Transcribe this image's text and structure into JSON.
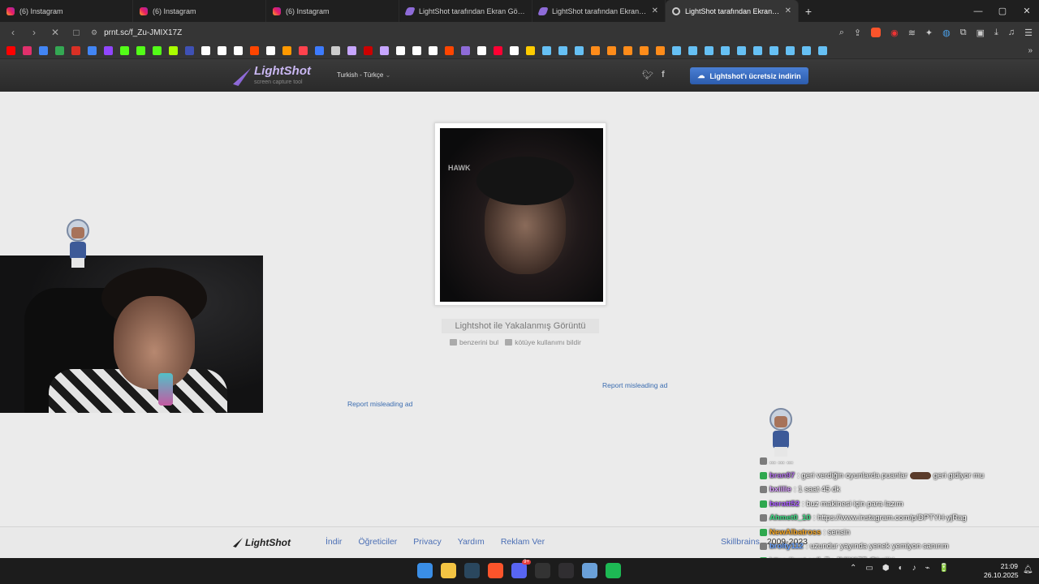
{
  "browser": {
    "tabs": [
      {
        "label": "(6) Instagram",
        "icon": "instagram-icon",
        "active": false
      },
      {
        "label": "(6) Instagram",
        "icon": "instagram-icon",
        "active": false
      },
      {
        "label": "(6) Instagram",
        "icon": "instagram-icon",
        "active": false
      },
      {
        "label": "LightShot tarafından Ekran Görüntüs",
        "icon": "lightshot-icon",
        "active": false
      },
      {
        "label": "LightShot tarafından Ekran Görü",
        "icon": "lightshot-icon",
        "active": false
      },
      {
        "label": "LightShot tarafından Ekran Görü",
        "icon": "loading-icon",
        "active": true
      }
    ],
    "tab_close": "✕",
    "new_tab": "+",
    "window_controls": {
      "minimize": "—",
      "maximize": "▢",
      "close": "✕"
    },
    "url": "prnt.sc/f_Zu-JMIX17Z",
    "bookmark_colors": [
      "#ff0000",
      "#e1306c",
      "#4285f4",
      "#34a853",
      "#d93025",
      "#4285f4",
      "#9146ff",
      "#53fc18",
      "#53fc18",
      "#53fc18",
      "#aaff00",
      "#3f51b5",
      "#ffffff",
      "#ffffff",
      "#ffffff",
      "#ff4500",
      "#ffffff",
      "#ff9900",
      "#ff424d",
      "#3d7bff",
      "#cccccc",
      "#c7a6ff",
      "#cc0000",
      "#c7a6ff",
      "#ffffff",
      "#ffffff",
      "#ffffff",
      "#ff4500",
      "#8e6bd8",
      "#ffffff",
      "#ff0033",
      "#ffffff",
      "#ffcc00",
      "#66c0f4",
      "#66c0f4",
      "#66c0f4",
      "#ff8c1a",
      "#ff8c1a",
      "#ff8c1a",
      "#ff8c1a",
      "#ff8c1a",
      "#66c0f4",
      "#66c0f4",
      "#66c0f4",
      "#66c0f4",
      "#66c0f4",
      "#66c0f4",
      "#66c0f4",
      "#66c0f4",
      "#66c0f4",
      "#66c0f4"
    ],
    "bookmarks_more": "»"
  },
  "lightshot": {
    "logo": "LightShot",
    "logo_sub": "screen capture tool",
    "language": "Turkish - Türkçe",
    "download_button": "Lightshot'ı ücretsiz indirin",
    "screenshot_label": "HAWK",
    "caption": "Lightshot ile Yakalanmış Görüntü",
    "actions": {
      "similar": "benzerini bul",
      "report": "kötüye kullanımı bildir"
    },
    "report_ad_1": "Report misleading ad",
    "report_ad_2": "Report misleading ad",
    "footer": {
      "logo": "LightShot",
      "links": [
        "İndir",
        "Öğreticiler",
        "Privacy",
        "Yardım",
        "Reklam Ver"
      ],
      "skillbrains": "Skillbrains",
      "year": "2009-2023"
    }
  },
  "chat": [
    {
      "user": "",
      "user_color": "#ffffff",
      "text": "... ... ..."
    },
    {
      "user": "bran97",
      "user_color": "#b06ee8",
      "text": ": geri verdiğin oyunlarda puanlar",
      "tail": "geri gidiyor mu"
    },
    {
      "user": "bxiilie",
      "user_color": "#d89cff",
      "text": ": 1 saat 45 dk"
    },
    {
      "user": "beratt52",
      "user_color": "#a95cff",
      "text": ": buz makinesi için para lazım"
    },
    {
      "user": "Ahmet0_10",
      "user_color": "#3ddc84",
      "text": ": https://www.instagram.com/p/DPTYH-yjRag"
    },
    {
      "user": "NewAlbatross",
      "user_color": "#f5a623",
      "text": ": sensin"
    },
    {
      "user": "brolty112",
      "user_color": "#6aa3ff",
      "text": ": uzundur yayında yenek yemiyon sanırım"
    },
    {
      "user": "",
      "user_color": "#ffffff",
      "text": "https://prnt.sc/f_Zu-JMIX17Z @kajjiri"
    }
  ],
  "taskbar": {
    "apps": [
      {
        "name": "windows-start-icon",
        "color": "#3a8ee6"
      },
      {
        "name": "file-explorer-icon",
        "color": "#f3c443"
      },
      {
        "name": "steam-icon",
        "color": "#2a475e"
      },
      {
        "name": "brave-icon",
        "color": "#fb542b"
      },
      {
        "name": "discord-icon",
        "color": "#5865f2",
        "badge": "9+"
      },
      {
        "name": "epic-games-icon",
        "color": "#333333"
      },
      {
        "name": "obs-icon",
        "color": "#302e31"
      },
      {
        "name": "settings-icon",
        "color": "#6aa0d8"
      },
      {
        "name": "spotify-icon",
        "color": "#1db954"
      }
    ],
    "tray": [
      "⌃",
      "▭",
      "⬢",
      "◐",
      "♪",
      "⌁",
      "🔋"
    ],
    "time": "21:09",
    "date": "26.10.2025"
  }
}
